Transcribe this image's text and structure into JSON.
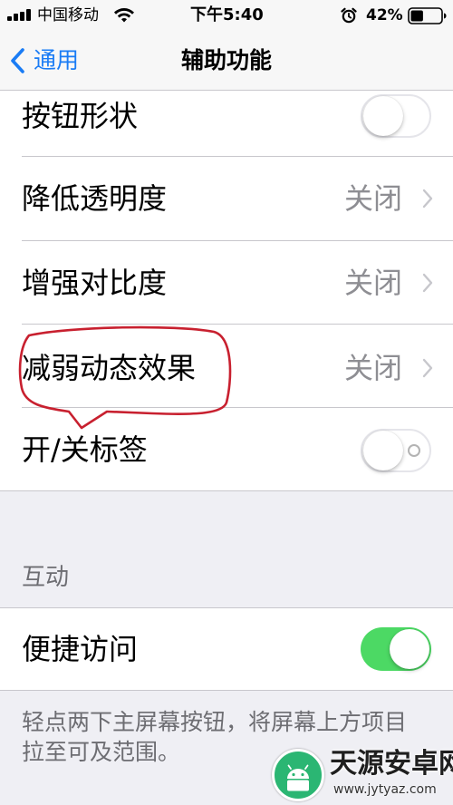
{
  "status_bar": {
    "carrier": "中国移动",
    "time": "下午5:40",
    "battery": "42%",
    "battery_level": 0.42,
    "icons": [
      "signal-icon",
      "wifi-icon",
      "alarm-icon",
      "battery-icon"
    ]
  },
  "nav": {
    "back_label": "通用",
    "title": "辅助功能"
  },
  "rows": [
    {
      "label": "按钮形状",
      "type": "toggle",
      "on": false
    },
    {
      "label": "降低透明度",
      "type": "value",
      "value": "关闭"
    },
    {
      "label": "增强对比度",
      "type": "value",
      "value": "关闭"
    },
    {
      "label": "减弱动态效果",
      "type": "value",
      "value": "关闭"
    },
    {
      "label": "开/关标签",
      "type": "toggle",
      "on": false
    }
  ],
  "interaction_section": {
    "header": "互动",
    "row": {
      "label": "便捷访问",
      "type": "toggle",
      "on": true
    },
    "footer": "轻点两下主屏幕按钮，将屏幕上方项目拉至可及范围。"
  },
  "watermark": {
    "title": "天源安卓网",
    "url": "www.jytyaz.com"
  },
  "colors": {
    "accent": "#1a7cf5",
    "toggle_on": "#4cd964",
    "annotation": "#c8202f",
    "secondary_text": "#8e8e93"
  }
}
